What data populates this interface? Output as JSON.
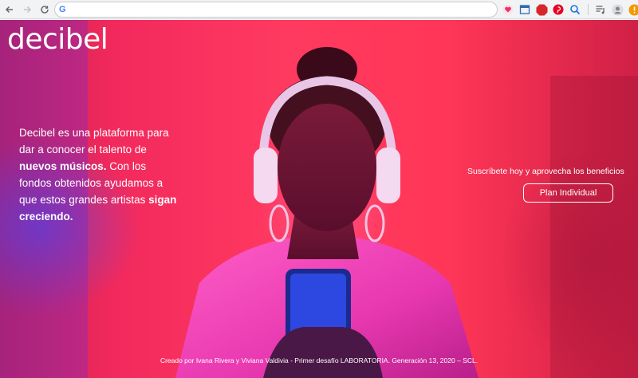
{
  "browser": {
    "back_icon": "arrow-left",
    "forward_icon": "arrow-right",
    "reload_icon": "reload",
    "omnibox_icon_letter": "G",
    "url": "",
    "extensions": [
      "heart-extension-icon",
      "window-extension-icon",
      "abp-extension-icon",
      "pinterest-extension-icon",
      "magnifier-extension-icon"
    ],
    "abp_label": "ABP",
    "menu_icons": [
      "playlist-icon",
      "profile-icon",
      "update-icon"
    ]
  },
  "site": {
    "logo": "decibel",
    "intro": {
      "part1": "Decibel es una plataforma para dar a conocer el talento de ",
      "bold1": "nuevos músicos.",
      "part2": " Con los fondos obtenidos ayudamos a que estos grandes artistas ",
      "bold2": "sigan creciendo."
    },
    "cta_text": "Suscríbete hoy y aprovecha los beneficios",
    "cta_button": "Plan Individual",
    "footer": "Creado por Ivana Rivera y Viviana Valdivia - Primer desafío LABORATORIA. Generación 13, 2020 – SCL."
  },
  "colors": {
    "hero_red": "#ff3a60",
    "hero_blue": "#3c50ff",
    "text": "#ffffff"
  }
}
